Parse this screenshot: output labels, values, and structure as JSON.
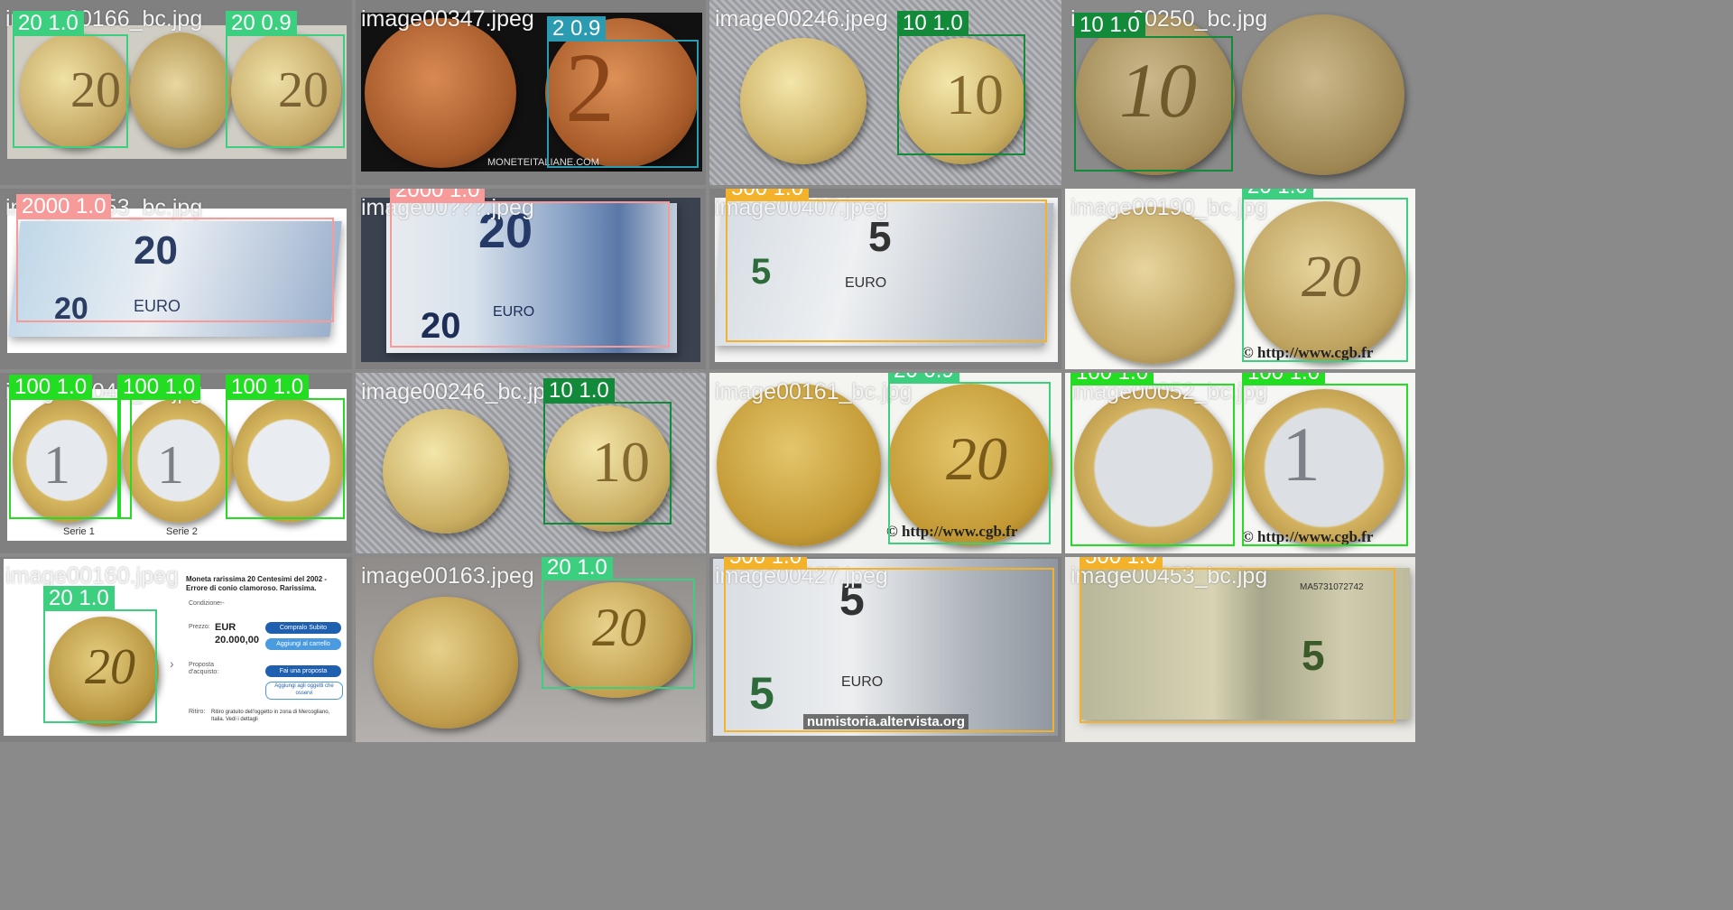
{
  "cells": [
    {
      "filename": "image00166_bc.jpg",
      "detections": [
        {
          "label": "20 1.0"
        },
        {
          "label": "20 0.9"
        }
      ]
    },
    {
      "filename": "image00347.jpeg",
      "detections": [
        {
          "label": "2 0.9"
        }
      ],
      "caption": "MONETEITALIANE.COM"
    },
    {
      "filename": "image00246.jpeg",
      "detections": [
        {
          "label": "10 1.0"
        }
      ]
    },
    {
      "filename": "image00250_bc.jpg",
      "detections": [
        {
          "label": "10 1.0"
        }
      ]
    },
    {
      "filename": "image00553_bc.jpg",
      "detections": [
        {
          "label": "2000 1.0"
        }
      ]
    },
    {
      "filename": "image00???.jpeg",
      "detections": [
        {
          "label": "2000 1.0"
        }
      ]
    },
    {
      "filename": "image00407.jpeg",
      "detections": [
        {
          "label": "500 1.0"
        }
      ]
    },
    {
      "filename": "image00190_bc.jpg",
      "detections": [
        {
          "label": "20 1.0"
        }
      ],
      "caption": "© http://www.cgb.fr"
    },
    {
      "filename": "image00046_bc.jpg",
      "detections": [
        {
          "label": "100 1.0"
        },
        {
          "label": "100 1.0"
        },
        {
          "label": "100 1.0"
        }
      ],
      "captions": [
        "Serie 1",
        "Serie 2"
      ]
    },
    {
      "filename": "image00246_bc.jpg",
      "detections": [
        {
          "label": "10 1.0"
        }
      ]
    },
    {
      "filename": "image00161_bc.jpg",
      "detections": [
        {
          "label": "20 0.9"
        }
      ],
      "caption": "© http://www.cgb.fr"
    },
    {
      "filename": "image00052_bc.jpg",
      "detections": [
        {
          "label": "100 1.0"
        },
        {
          "label": "100 1.0"
        }
      ],
      "caption": "© http://www.cgb.fr"
    },
    {
      "filename": "image00160.jpeg",
      "detections": [
        {
          "label": "20 1.0"
        }
      ],
      "listing": {
        "title": "Moneta rarissima 20 Centesimi del 2002 - Errore di conio clamoroso. Rarissima.",
        "condition_label": "Condizione:",
        "condition_value": "--",
        "price_label": "Prezzo:",
        "currency": "EUR",
        "price": "20.000,00",
        "buy_button": "Compralo Subito",
        "cart_button": "Aggiungi al carrello",
        "offer_label": "Proposta d'acquisto:",
        "offer_button": "Fai una proposta",
        "watch_button": "Aggiungi agli oggetti che osservi",
        "shipping_label": "Ritiro:",
        "shipping_value": "Ritiro gratuito dell'oggetto in zona di Mercogliano, Italia. Vedi i dettagli"
      }
    },
    {
      "filename": "image00163.jpeg",
      "detections": [
        {
          "label": "20 1.0"
        }
      ]
    },
    {
      "filename": "image00427.jpeg",
      "detections": [
        {
          "label": "500 1.0"
        }
      ],
      "caption": "numistoria.altervista.org"
    },
    {
      "filename": "image00453_bc.jpg",
      "detections": [
        {
          "label": "500 1.0"
        }
      ],
      "serial": "MA5731072742"
    }
  ],
  "class_colors": {
    "2": "#2a9bb0",
    "10": "#138a3a",
    "20": "#3ccf7f",
    "100": "#22dd22",
    "500": "#f4b12a",
    "2000": "#f79a9a"
  }
}
